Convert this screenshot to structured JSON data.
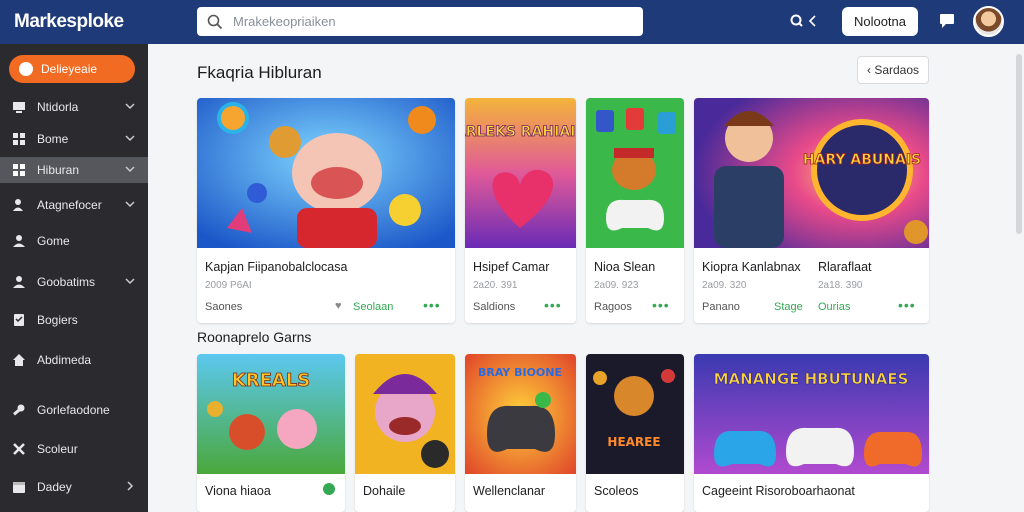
{
  "app": {
    "title": "Markesploke"
  },
  "search": {
    "placeholder": "Mrakekeopriaiken"
  },
  "header": {
    "login_label": "Nolootna"
  },
  "sidebar": {
    "primary_label": "Delieyeaie",
    "items": [
      {
        "label": "Ntidorla",
        "has_chevron": true
      },
      {
        "label": "Bome",
        "has_chevron": true
      },
      {
        "label": "Hiburan",
        "has_chevron": true
      },
      {
        "label": "Atagnefocer",
        "has_chevron": true
      },
      {
        "label": "Gome",
        "has_chevron": false
      },
      {
        "label": "Goobatims",
        "has_chevron": true
      },
      {
        "label": "Bogiers",
        "has_chevron": false
      },
      {
        "label": "Abdimeda",
        "has_chevron": false
      },
      {
        "label": "Gorlefaodone",
        "has_chevron": false
      },
      {
        "label": "Scoleur",
        "has_chevron": false
      },
      {
        "label": "Dadey",
        "has_chevron": true
      }
    ]
  },
  "main": {
    "section_title": "Fkaqria Hibluran",
    "sort_label": "Sardaos",
    "row1": [
      {
        "title": "Kapjan Fiipanobalclocasa",
        "sub": "2009 P6AI",
        "meta": "Saones",
        "tag": "Seolaan",
        "dots": "•••"
      },
      {
        "title": "Hsipef Camar",
        "sub": "2a20. 391",
        "meta": "Saldions",
        "tag": "",
        "dots": "•••"
      },
      {
        "title": "Nioa Slean",
        "sub": "2a09. 923",
        "meta": "Ragoos",
        "tag": "",
        "dots": "•••"
      },
      {
        "title": "Kiopra Kanlabnax",
        "sub": "2a09. 320",
        "meta": "Panano",
        "tag": "Stage",
        "dots": ""
      },
      {
        "title": "Rlaraflaat",
        "sub": "2a18. 390",
        "meta": "",
        "tag": "Ourias",
        "dots": "•••"
      }
    ],
    "section2_title": "Roonaprelo Garns",
    "row2": [
      {
        "title": "Viona hiaoa"
      },
      {
        "title": "Dohaile"
      },
      {
        "title": "Wellenclanar"
      },
      {
        "title": "Scoleos"
      },
      {
        "title": "Cageeint Risoroboarhaonat"
      }
    ],
    "banners": {
      "hero_text": "HARY ABUNAIS",
      "tile2_text": "HARLEKS RAHIAIUS",
      "row2_tile1_text": "KREALS",
      "row2_tile3_text": "BRAY BIOONE",
      "row2_tile4_text": "HEAREE",
      "row2_tile5_text": "MANANGE HBUTUNAES"
    }
  }
}
